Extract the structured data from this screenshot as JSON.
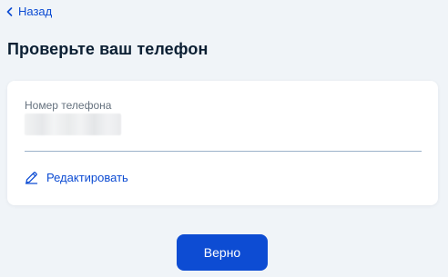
{
  "back": {
    "label": "Назад",
    "icon": "chevron-left-icon"
  },
  "page_title": "Проверьте ваш телефон",
  "phone_field": {
    "label": "Номер телефона",
    "value": ""
  },
  "edit": {
    "label": "Редактировать",
    "icon": "pencil-icon"
  },
  "submit": {
    "label": "Верно"
  },
  "colors": {
    "accent": "#0d4cd3",
    "background": "#f0f4f8",
    "card": "#ffffff",
    "title": "#0b1f33",
    "label": "#66727f"
  }
}
